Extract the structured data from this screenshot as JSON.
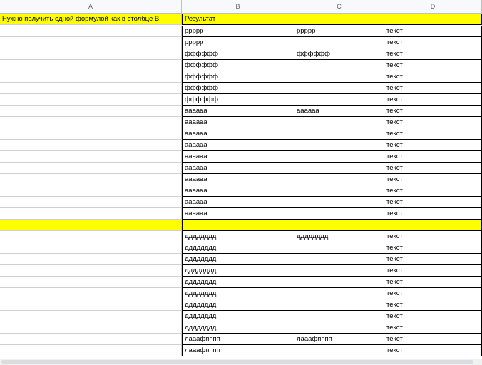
{
  "columns": [
    "A",
    "B",
    "C",
    "D"
  ],
  "rows": [
    {
      "a": "Нужно получить одной формулой как в столбце B",
      "b": "Результат",
      "c": "",
      "d": "",
      "hl": true
    },
    {
      "a": "",
      "b": "ррррр",
      "c": "ррррр",
      "d": "текст"
    },
    {
      "a": "",
      "b": "ррррр",
      "c": "",
      "d": "текст"
    },
    {
      "a": "",
      "b": "фффффф",
      "c": "фффффф",
      "d": "текст"
    },
    {
      "a": "",
      "b": "фффффф",
      "c": "",
      "d": "текст"
    },
    {
      "a": "",
      "b": "фффффф",
      "c": "",
      "d": "текст"
    },
    {
      "a": "",
      "b": "фффффф",
      "c": "",
      "d": "текст"
    },
    {
      "a": "",
      "b": "фффффф",
      "c": "",
      "d": "текст"
    },
    {
      "a": "",
      "b": "аааааа",
      "c": "аааааа",
      "d": "текст"
    },
    {
      "a": "",
      "b": "аааааа",
      "c": "",
      "d": "текст"
    },
    {
      "a": "",
      "b": "аааааа",
      "c": "",
      "d": "текст"
    },
    {
      "a": "",
      "b": "аааааа",
      "c": "",
      "d": "текст"
    },
    {
      "a": "",
      "b": "аааааа",
      "c": "",
      "d": "текст"
    },
    {
      "a": "",
      "b": "аааааа",
      "c": "",
      "d": "текст"
    },
    {
      "a": "",
      "b": "аааааа",
      "c": "",
      "d": "текст"
    },
    {
      "a": "",
      "b": "аааааа",
      "c": "",
      "d": "текст"
    },
    {
      "a": "",
      "b": "аааааа",
      "c": "",
      "d": "текст"
    },
    {
      "a": "",
      "b": "аааааа",
      "c": "",
      "d": "текст"
    },
    {
      "a": "",
      "b": "",
      "c": "",
      "d": "",
      "hl": true
    },
    {
      "a": "",
      "b": "дддддддд",
      "c": "дддддддд",
      "d": "текст"
    },
    {
      "a": "",
      "b": "дддддддд",
      "c": "",
      "d": "текст"
    },
    {
      "a": "",
      "b": "дддддддд",
      "c": "",
      "d": "текст"
    },
    {
      "a": "",
      "b": "дддддддд",
      "c": "",
      "d": "текст"
    },
    {
      "a": "",
      "b": "дддддддд",
      "c": "",
      "d": "текст"
    },
    {
      "a": "",
      "b": "дддддддд",
      "c": "",
      "d": "текст"
    },
    {
      "a": "",
      "b": "дддддддд",
      "c": "",
      "d": "текст"
    },
    {
      "a": "",
      "b": "дддддддд",
      "c": "",
      "d": "текст"
    },
    {
      "a": "",
      "b": "дддддддд",
      "c": "",
      "d": "текст"
    },
    {
      "a": "",
      "b": "лааафпппп",
      "c": "лааафпппп",
      "d": "текст"
    },
    {
      "a": "",
      "b": "лааафпппп",
      "c": "",
      "d": "текст"
    }
  ],
  "colors": {
    "highlight": "#ffff00",
    "header_bg": "#f8f9fa"
  }
}
